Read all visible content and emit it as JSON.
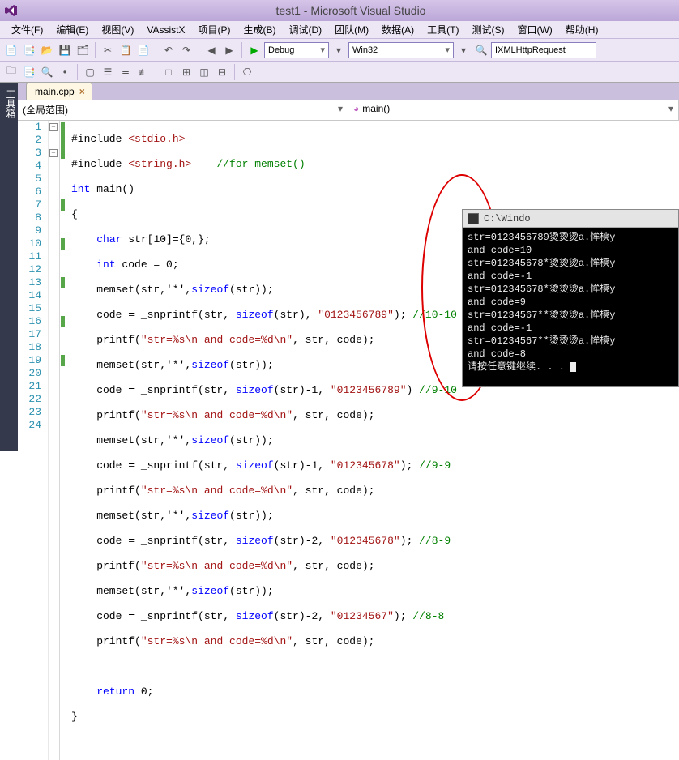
{
  "title": "test1 - Microsoft Visual Studio",
  "menu": [
    "文件(F)",
    "编辑(E)",
    "视图(V)",
    "VAssistX",
    "项目(P)",
    "生成(B)",
    "调试(D)",
    "团队(M)",
    "数据(A)",
    "工具(T)",
    "测试(S)",
    "窗口(W)",
    "帮助(H)"
  ],
  "toolbar1": {
    "config": "Debug",
    "platform": "Win32",
    "quickfind": "IXMLHttpRequest"
  },
  "sidebar_label": "工具箱",
  "tab": {
    "file": "main.cpp"
  },
  "scope": {
    "left": "(全局范围)",
    "right": "main()"
  },
  "code": {
    "l1": "#include ",
    "l1inc": "<stdio.h>",
    "l2": "#include ",
    "l2inc": "<string.h>",
    "l2cmt": "    //for memset()",
    "l3": "int",
    "l3b": " main()",
    "l4": "{",
    "l5a": "    ",
    "l5kw": "char",
    "l5b": " str[10]={0,};",
    "l6a": "    ",
    "l6kw": "int",
    "l6b": " code = 0;",
    "l7": "    memset(str,'*',",
    "l7kw": "sizeof",
    "l7b": "(str));",
    "l8": "    code = _snprintf(str, ",
    "l8kw": "sizeof",
    "l8mid": "(str), ",
    "l8str": "\"0123456789\"",
    "l8end": ");",
    "l8cmt": " //10-10",
    "l9": "    printf(",
    "l9str": "\"str=%s\\n and code=%d\\n\"",
    "l9end": ", str, code);",
    "l10": "    memset(str,'*',",
    "l10kw": "sizeof",
    "l10b": "(str));",
    "l11": "    code = _snprintf(str, ",
    "l11kw": "sizeof",
    "l11mid": "(str)-1, ",
    "l11str": "\"0123456789\"",
    "l11end": ")",
    "l11cmt": " //9-10",
    "l12": "    printf(",
    "l12str": "\"str=%s\\n and code=%d\\n\"",
    "l12end": ", str, code);",
    "l13": "    memset(str,'*',",
    "l13kw": "sizeof",
    "l13b": "(str));",
    "l14": "    code = _snprintf(str, ",
    "l14kw": "sizeof",
    "l14mid": "(str)-1, ",
    "l14str": "\"012345678\"",
    "l14end": ");",
    "l14cmt": " //9-9",
    "l15": "    printf(",
    "l15str": "\"str=%s\\n and code=%d\\n\"",
    "l15end": ", str, code);",
    "l16": "    memset(str,'*',",
    "l16kw": "sizeof",
    "l16b": "(str));",
    "l17": "    code = _snprintf(str, ",
    "l17kw": "sizeof",
    "l17mid": "(str)-2, ",
    "l17str": "\"012345678\"",
    "l17end": ");",
    "l17cmt": " //8-9",
    "l18": "    printf(",
    "l18str": "\"str=%s\\n and code=%d\\n\"",
    "l18end": ", str, code);",
    "l19": "    memset(str,'*',",
    "l19kw": "sizeof",
    "l19b": "(str));",
    "l20": "    code = _snprintf(str, ",
    "l20kw": "sizeof",
    "l20mid": "(str)-2, ",
    "l20str": "\"01234567\"",
    "l20end": ");",
    "l20cmt": " //8-8",
    "l21": "    printf(",
    "l21str": "\"str=%s\\n and code=%d\\n\"",
    "l21end": ", str, code);",
    "l22": "",
    "l23": "    ",
    "l23kw": "return",
    "l23b": " 0;",
    "l24": "}"
  },
  "line_numbers": [
    "1",
    "2",
    "3",
    "4",
    "5",
    "6",
    "7",
    "8",
    "9",
    "10",
    "11",
    "12",
    "13",
    "14",
    "15",
    "16",
    "17",
    "18",
    "19",
    "20",
    "21",
    "22",
    "23",
    "24"
  ],
  "console": {
    "title": "C:\\Windo",
    "lines": [
      "str=0123456789烫烫烫a.恈樉y",
      " and code=10",
      "str=012345678*烫烫烫a.恈樉y",
      " and code=-1",
      "str=012345678*烫烫烫a.恈樉y",
      " and code=9",
      "str=01234567**烫烫烫a.恈樉y",
      " and code=-1",
      "str=01234567**烫烫烫a.恈樉y",
      " and code=8",
      "请按任意键继续. . . "
    ]
  }
}
